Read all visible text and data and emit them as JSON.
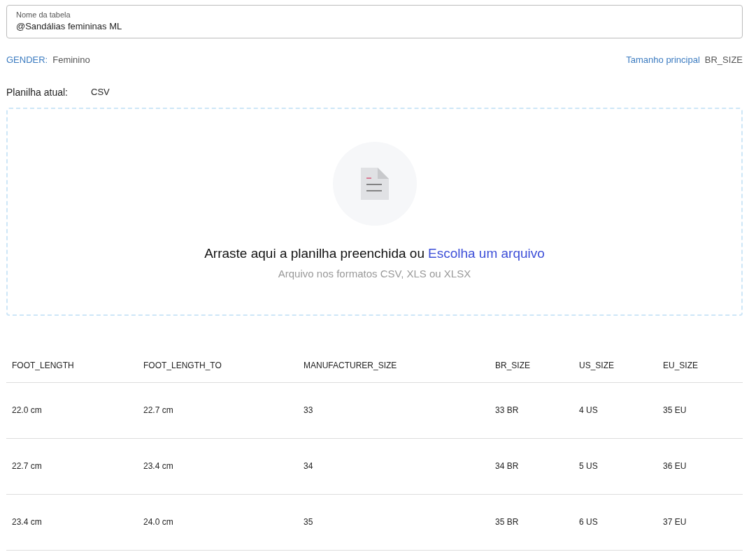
{
  "name_field": {
    "label": "Nome da tabela",
    "value": "@Sandálias femininas ML"
  },
  "gender": {
    "label": "GENDER:",
    "value": "Feminino"
  },
  "main_size": {
    "label": "Tamanho principal",
    "value": "BR_SIZE"
  },
  "current_sheet": {
    "label": "Planilha atual:",
    "value": "CSV"
  },
  "dropzone": {
    "text": "Arraste aqui a planilha preenchida ou",
    "link": "Escolha um arquivo",
    "hint": "Arquivo nos formatos CSV, XLS ou XLSX"
  },
  "table": {
    "columns": [
      "FOOT_LENGTH",
      "FOOT_LENGTH_TO",
      "MANUFACTURER_SIZE",
      "BR_SIZE",
      "US_SIZE",
      "EU_SIZE"
    ],
    "rows": [
      [
        "22.0 cm",
        "22.7 cm",
        "33",
        "33 BR",
        "4 US",
        "35 EU"
      ],
      [
        "22.7 cm",
        "23.4 cm",
        "34",
        "34 BR",
        "5 US",
        "36 EU"
      ],
      [
        "23.4 cm",
        "24.0 cm",
        "35",
        "35 BR",
        "6 US",
        "37 EU"
      ]
    ]
  }
}
